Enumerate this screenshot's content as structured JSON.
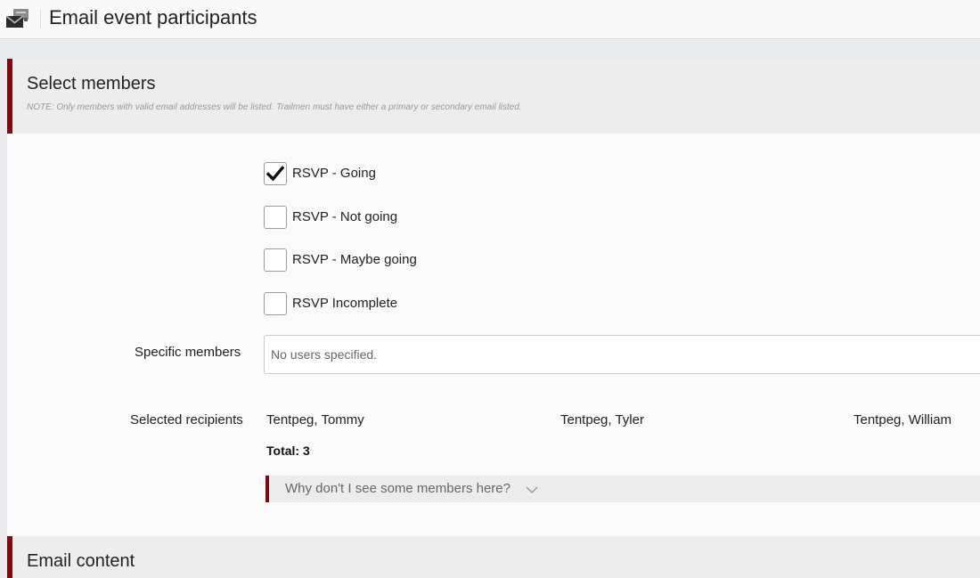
{
  "header": {
    "title": "Email event participants",
    "icon": "email-icon"
  },
  "select_members": {
    "heading": "Select members",
    "note": "NOTE: Only members with valid email addresses will be listed. Trailmen must have either a primary or secondary email listed.",
    "rsvp_options": [
      {
        "label": "RSVP - Going",
        "checked": true
      },
      {
        "label": "RSVP - Not going",
        "checked": false
      },
      {
        "label": "RSVP - Maybe going",
        "checked": false
      },
      {
        "label": "RSVP Incomplete",
        "checked": false
      }
    ],
    "specific_members": {
      "label": "Specific members",
      "placeholder": "No users specified."
    },
    "selected_recipients": {
      "label": "Selected recipients",
      "names": [
        "Tentpeg, Tommy",
        "Tentpeg, Tyler",
        "Tentpeg, William"
      ],
      "total_text": "Total: 3"
    },
    "why_toggle": "Why don't I see some members here?"
  },
  "email_content": {
    "heading": "Email content"
  },
  "colors": {
    "accent": "#7a0c12",
    "header_bg": "#ededed",
    "panel_bg": "#fafafa"
  }
}
